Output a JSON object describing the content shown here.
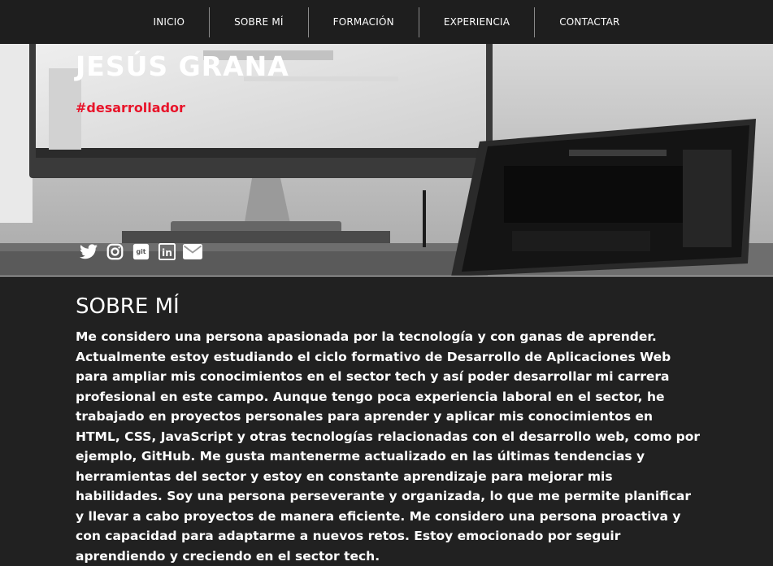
{
  "nav": {
    "items": [
      {
        "label": "INICIO"
      },
      {
        "label": "SOBRE MÍ"
      },
      {
        "label": "FORMACIÓN"
      },
      {
        "label": "EXPERIENCIA"
      },
      {
        "label": "CONTACTAR"
      }
    ]
  },
  "hero": {
    "name": "JESÚS GRANA",
    "tagline": "#desarrollador",
    "tagline_color": "#e8142a",
    "socials": [
      {
        "icon": "twitter-icon"
      },
      {
        "icon": "instagram-icon"
      },
      {
        "icon": "git-icon",
        "text": "git"
      },
      {
        "icon": "linkedin-icon",
        "text": "in"
      },
      {
        "icon": "envelope-icon"
      }
    ]
  },
  "about": {
    "title": "SOBRE MÍ",
    "text": "Me considero una persona apasionada por la tecnología y con ganas de aprender. Actualmente estoy estudiando el ciclo formativo de Desarrollo de Aplicaciones Web para ampliar mis conocimientos en el sector tech y así poder desarrollar mi carrera profesional en este campo. Aunque tengo poca experiencia laboral en el sector, he trabajado en proyectos personales para aprender y aplicar mis conocimientos en HTML, CSS, JavaScript y otras tecnologías relacionadas con el desarrollo web, como por ejemplo, GitHub. Me gusta mantenerme actualizado en las últimas tendencias y herramientas del sector y estoy en constante aprendizaje para mejorar mis habilidades. Soy una persona perseverante y organizada, lo que me permite planificar y llevar a cabo proyectos de manera eficiente. Me considero una persona proactiva y con capacidad para adaptarme a nuevos retos. Estoy emocionado por seguir aprendiendo y creciendo en el sector tech."
  }
}
